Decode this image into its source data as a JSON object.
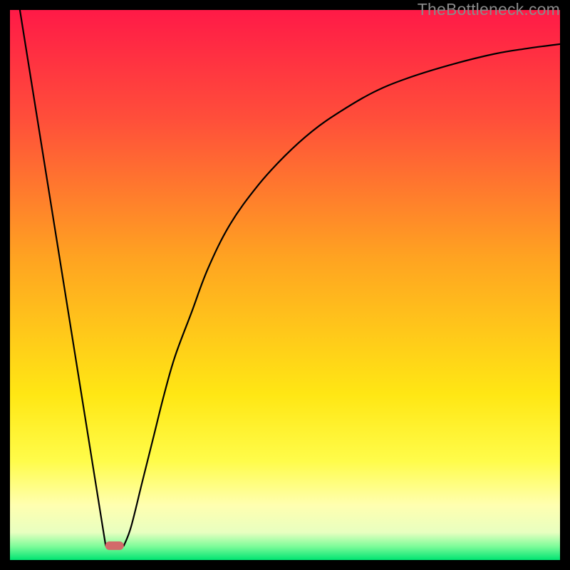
{
  "watermark": "TheBottleneck.com",
  "chart_data": {
    "type": "line",
    "title": "",
    "xlabel": "",
    "ylabel": "",
    "x_range": [
      0,
      100
    ],
    "y_range": [
      0,
      100
    ],
    "gradient_stops": [
      {
        "pos": 0.0,
        "color": "#ff1a47"
      },
      {
        "pos": 0.2,
        "color": "#ff4f3a"
      },
      {
        "pos": 0.45,
        "color": "#ffa321"
      },
      {
        "pos": 0.7,
        "color": "#ffe714"
      },
      {
        "pos": 0.82,
        "color": "#fffc4a"
      },
      {
        "pos": 0.9,
        "color": "#ffffb0"
      },
      {
        "pos": 0.95,
        "color": "#e8ffc0"
      },
      {
        "pos": 0.975,
        "color": "#7efc9a"
      },
      {
        "pos": 1.0,
        "color": "#00e472"
      }
    ],
    "series": [
      {
        "name": "left-limb",
        "type": "line",
        "x": [
          1.8,
          17.4
        ],
        "y": [
          100,
          2.6
        ]
      },
      {
        "name": "right-limb",
        "type": "line",
        "x": [
          20.7,
          22,
          24,
          26,
          28,
          30,
          33,
          36,
          40,
          45,
          50,
          55,
          60,
          66,
          72,
          80,
          88,
          94,
          100
        ],
        "y": [
          2.6,
          6,
          14,
          22,
          30,
          37,
          45,
          53,
          61,
          68,
          73.5,
          78,
          81.5,
          85,
          87.5,
          90,
          92,
          93,
          93.8
        ]
      }
    ],
    "marker": {
      "name": "bottleneck-marker",
      "x_center": 19.0,
      "y": 2.6,
      "width": 3.4,
      "color": "#d26a6a"
    }
  }
}
